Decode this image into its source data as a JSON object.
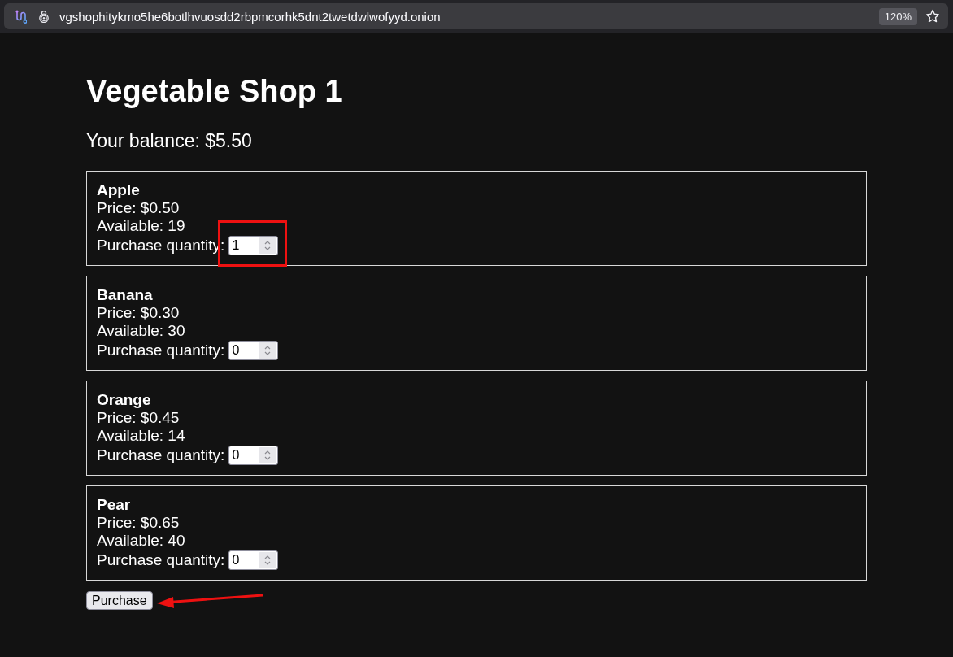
{
  "browser": {
    "url": "vgshophitykmo5he6botlhvuosdd2rbpmcorhk5dnt2twetdwlwofyyd.onion",
    "zoom": "120%"
  },
  "page": {
    "title": "Vegetable Shop 1",
    "balance": "Your balance: $5.50"
  },
  "products": [
    {
      "name": "Apple",
      "price": "Price: $0.50",
      "available": "Available: 19",
      "quantity_label": "Purchase quantity:",
      "quantity": "1",
      "highlighted": true
    },
    {
      "name": "Banana",
      "price": "Price: $0.30",
      "available": "Available: 30",
      "quantity_label": "Purchase quantity:",
      "quantity": "0",
      "highlighted": false
    },
    {
      "name": "Orange",
      "price": "Price: $0.45",
      "available": "Available: 14",
      "quantity_label": "Purchase quantity:",
      "quantity": "0",
      "highlighted": false
    },
    {
      "name": "Pear",
      "price": "Price: $0.65",
      "available": "Available: 40",
      "quantity_label": "Purchase quantity:",
      "quantity": "0",
      "highlighted": false
    }
  ],
  "purchase_button": {
    "label": "Purchase",
    "arrow": true
  }
}
